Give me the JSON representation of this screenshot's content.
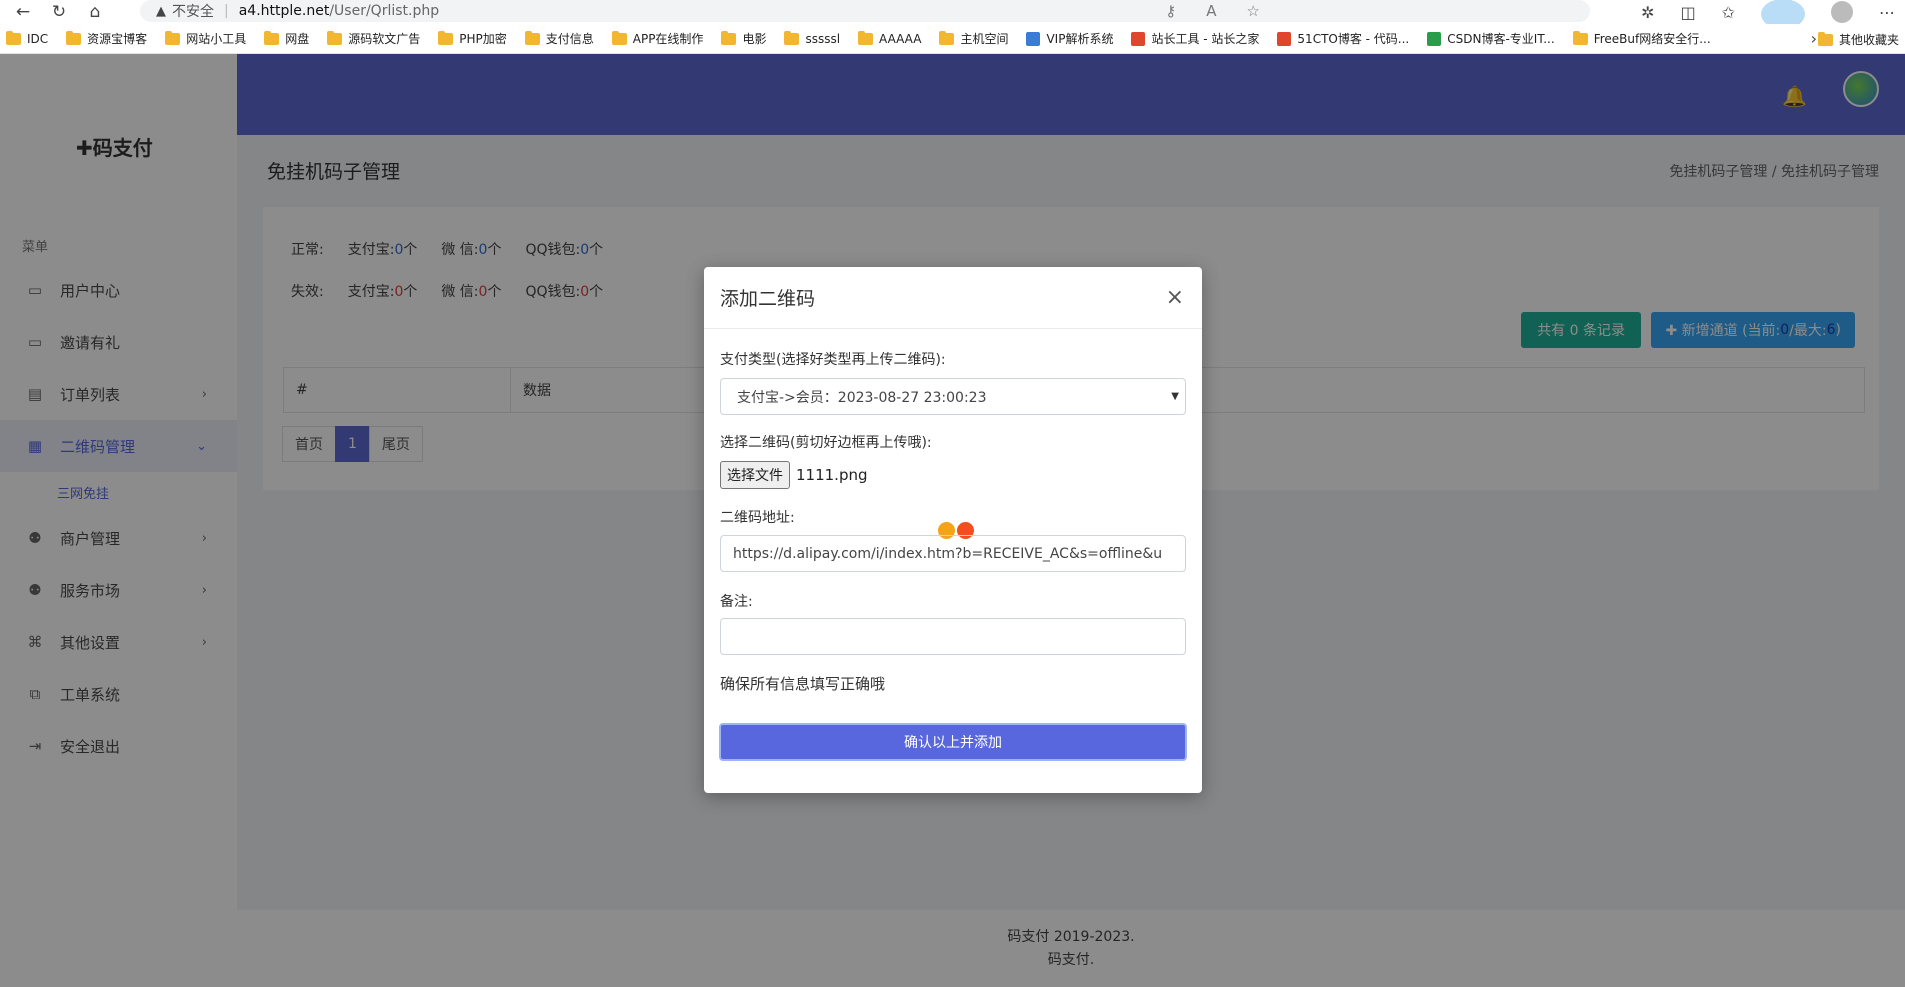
{
  "browser": {
    "insecure_label": "不安全",
    "url_host": "a4.httple.net",
    "url_path": "/User/Qrlist.php",
    "bookmarks": [
      {
        "label": "IDC"
      },
      {
        "label": "资源宝博客"
      },
      {
        "label": "网站小工具"
      },
      {
        "label": "网盘"
      },
      {
        "label": "源码软文广告"
      },
      {
        "label": "PHP加密"
      },
      {
        "label": "支付信息"
      },
      {
        "label": "APP在线制作"
      },
      {
        "label": "电影"
      },
      {
        "label": "sssssl"
      },
      {
        "label": "AAAAA"
      },
      {
        "label": "主机空间"
      },
      {
        "label": "VIP解析系统"
      },
      {
        "label": "站长工具 - 站长之家"
      },
      {
        "label": "51CTO博客 - 代码..."
      },
      {
        "label": "CSDN博客-专业IT..."
      },
      {
        "label": "FreeBuf网络安全行..."
      }
    ],
    "other_bookmarks": "其他收藏夹"
  },
  "sidebar": {
    "logo": "码支付",
    "menu_caption": "菜单",
    "items": [
      {
        "label": "用户中心",
        "icon": "monitor-icon"
      },
      {
        "label": "邀请有礼",
        "icon": "monitor-icon"
      },
      {
        "label": "订单列表",
        "icon": "list-icon"
      },
      {
        "label": "二维码管理",
        "icon": "qrcode-icon"
      },
      {
        "label": "商户管理",
        "icon": "users-icon"
      },
      {
        "label": "服务市场",
        "icon": "users-icon"
      },
      {
        "label": "其他设置",
        "icon": "command-icon"
      },
      {
        "label": "工单系统",
        "icon": "ticket-icon"
      },
      {
        "label": "安全退出",
        "icon": "logout-icon"
      }
    ],
    "submenu": "三网免挂"
  },
  "page": {
    "title": "免挂机码子管理",
    "breadcrumb_1": "免挂机码子管理",
    "breadcrumb_sep": "/",
    "breadcrumb_2": "免挂机码子管理",
    "normal_label": "正常:",
    "invalid_label": "失效:",
    "alipay_label": "支付宝:",
    "wechat_label": "微 信:",
    "qq_label": "QQ钱包:",
    "unit": "个",
    "normal": {
      "alipay": "0",
      "wechat": "0",
      "qq": "0"
    },
    "invalid": {
      "alipay": "0",
      "wechat": "0",
      "qq": "0"
    },
    "count_button": "共有 0 条记录",
    "add_button_prefix": "✚ 新增通道 (当前:",
    "add_current": "0",
    "add_mid": "/最大:",
    "add_max": "6",
    "add_suffix": ")",
    "table_headers": [
      "#",
      "数据"
    ],
    "pager": {
      "first": "首页",
      "current": "1",
      "last": "尾页"
    },
    "footer_1": "码支付 2019-2023.",
    "footer_2": "码支付."
  },
  "modal": {
    "title": "添加二维码",
    "close": "×",
    "type_label": "支付类型(选择好类型再上传二维码):",
    "type_value": "支付宝->会员：2023-08-27 23:00:23",
    "file_label": "选择二维码(剪切好边框再上传哦):",
    "file_button": "选择文件",
    "file_name": "1111.png",
    "url_label": "二维码地址:",
    "url_value": "https://d.alipay.com/i/index.htm?b=RECEIVE_AC&s=offline&u",
    "note_label": "备注:",
    "note_value": "",
    "hint": "确保所有信息填写正确哦",
    "submit": "确认以上并添加"
  },
  "colors": {
    "primary": "#5867dd",
    "topbar": "#5d6ad2",
    "teal": "#1fb29a",
    "info": "#37a6f5"
  }
}
